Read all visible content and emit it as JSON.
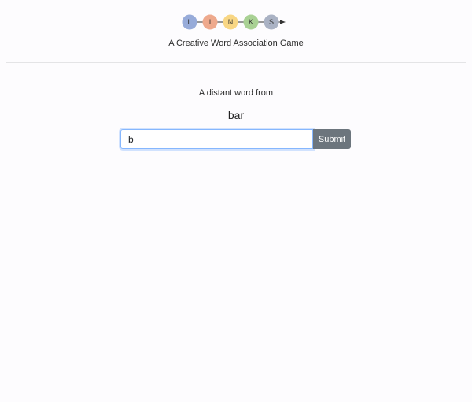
{
  "logo": {
    "letters": [
      {
        "letter": "L",
        "color": "#97abd9"
      },
      {
        "letter": "I",
        "color": "#eea98d"
      },
      {
        "letter": "N",
        "color": "#f8d684"
      },
      {
        "letter": "K",
        "color": "#a9d194"
      },
      {
        "letter": "S",
        "color": "#aab2c4"
      }
    ],
    "connector_color": "#333333"
  },
  "tagline": "A Creative Word Association Game",
  "game": {
    "prompt": "A distant word from",
    "target_word": "bar",
    "input_value": "b",
    "submit_label": "Submit"
  },
  "colors": {
    "input_focus_border": "#86b7fe",
    "submit_bg": "#6c757d"
  }
}
